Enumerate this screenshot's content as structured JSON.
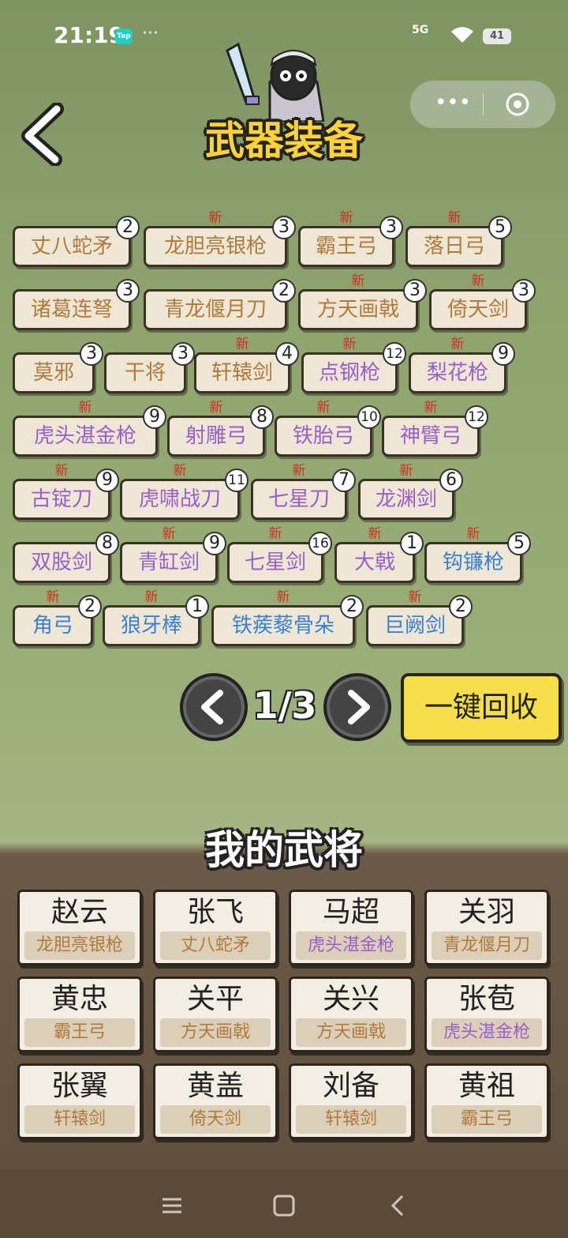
{
  "status": {
    "time": "21:19",
    "tap": "Tap",
    "dots": "···",
    "network": "5G",
    "battery": "41"
  },
  "header": {
    "title": "武器装备"
  },
  "weapons": [
    {
      "name": "丈八蛇矛",
      "count": "2",
      "new": "",
      "color": "orange"
    },
    {
      "name": "龙胆亮银枪",
      "count": "3",
      "new": "新",
      "color": "orange"
    },
    {
      "name": "霸王弓",
      "count": "3",
      "new": "新",
      "color": "orange"
    },
    {
      "name": "落日弓",
      "count": "5",
      "new": "新",
      "color": "orange"
    },
    {
      "name": "诸葛连弩",
      "count": "3",
      "new": "",
      "color": "orange"
    },
    {
      "name": "青龙偃月刀",
      "count": "2",
      "new": "",
      "color": "orange"
    },
    {
      "name": "方天画戟",
      "count": "3",
      "new": "新",
      "color": "orange"
    },
    {
      "name": "倚天剑",
      "count": "3",
      "new": "新",
      "color": "orange"
    },
    {
      "name": "莫邪",
      "count": "3",
      "new": "",
      "color": "orange"
    },
    {
      "name": "干将",
      "count": "3",
      "new": "",
      "color": "orange"
    },
    {
      "name": "轩辕剑",
      "count": "4",
      "new": "新",
      "color": "orange"
    },
    {
      "name": "点钢枪",
      "count": "12",
      "new": "新",
      "color": "purple"
    },
    {
      "name": "梨花枪",
      "count": "9",
      "new": "新",
      "color": "purple"
    },
    {
      "name": "虎头湛金枪",
      "count": "9",
      "new": "新",
      "color": "purple"
    },
    {
      "name": "射雕弓",
      "count": "8",
      "new": "新",
      "color": "purple"
    },
    {
      "name": "铁胎弓",
      "count": "10",
      "new": "新",
      "color": "purple"
    },
    {
      "name": "神臂弓",
      "count": "12",
      "new": "新",
      "color": "purple"
    },
    {
      "name": "古锭刀",
      "count": "9",
      "new": "新",
      "color": "purple"
    },
    {
      "name": "虎啸战刀",
      "count": "11",
      "new": "新",
      "color": "purple"
    },
    {
      "name": "七星刀",
      "count": "7",
      "new": "新",
      "color": "purple"
    },
    {
      "name": "龙渊剑",
      "count": "6",
      "new": "新",
      "color": "purple"
    },
    {
      "name": "双股剑",
      "count": "8",
      "new": "",
      "color": "purple"
    },
    {
      "name": "青缸剑",
      "count": "9",
      "new": "新",
      "color": "purple"
    },
    {
      "name": "七星剑",
      "count": "16",
      "new": "新",
      "color": "purple"
    },
    {
      "name": "大戟",
      "count": "1",
      "new": "新",
      "color": "purple"
    },
    {
      "name": "钩镰枪",
      "count": "5",
      "new": "新",
      "color": "blue"
    },
    {
      "name": "角弓",
      "count": "2",
      "new": "新",
      "color": "blue"
    },
    {
      "name": "狼牙棒",
      "count": "1",
      "new": "新",
      "color": "blue"
    },
    {
      "name": "铁蒺藜骨朵",
      "count": "2",
      "new": "新",
      "color": "blue"
    },
    {
      "name": "巨阙剑",
      "count": "2",
      "new": "新",
      "color": "blue"
    }
  ],
  "pager": {
    "text": "1/3"
  },
  "recycle_label": "一键回收",
  "generals_title": "我的武将",
  "generals": [
    {
      "name": "赵云",
      "weapon": "龙胆亮银枪",
      "color": "orange"
    },
    {
      "name": "张飞",
      "weapon": "丈八蛇矛",
      "color": "orange"
    },
    {
      "name": "马超",
      "weapon": "虎头湛金枪",
      "color": "purple"
    },
    {
      "name": "关羽",
      "weapon": "青龙偃月刀",
      "color": "orange"
    },
    {
      "name": "黄忠",
      "weapon": "霸王弓",
      "color": "orange"
    },
    {
      "name": "关平",
      "weapon": "方天画戟",
      "color": "orange"
    },
    {
      "name": "关兴",
      "weapon": "方天画戟",
      "color": "orange"
    },
    {
      "name": "张苞",
      "weapon": "虎头湛金枪",
      "color": "purple"
    },
    {
      "name": "张翼",
      "weapon": "轩辕剑",
      "color": "orange"
    },
    {
      "name": "黄盖",
      "weapon": "倚天剑",
      "color": "orange"
    },
    {
      "name": "刘备",
      "weapon": "轩辕剑",
      "color": "orange"
    },
    {
      "name": "黄祖",
      "weapon": "霸王弓",
      "color": "orange"
    }
  ]
}
